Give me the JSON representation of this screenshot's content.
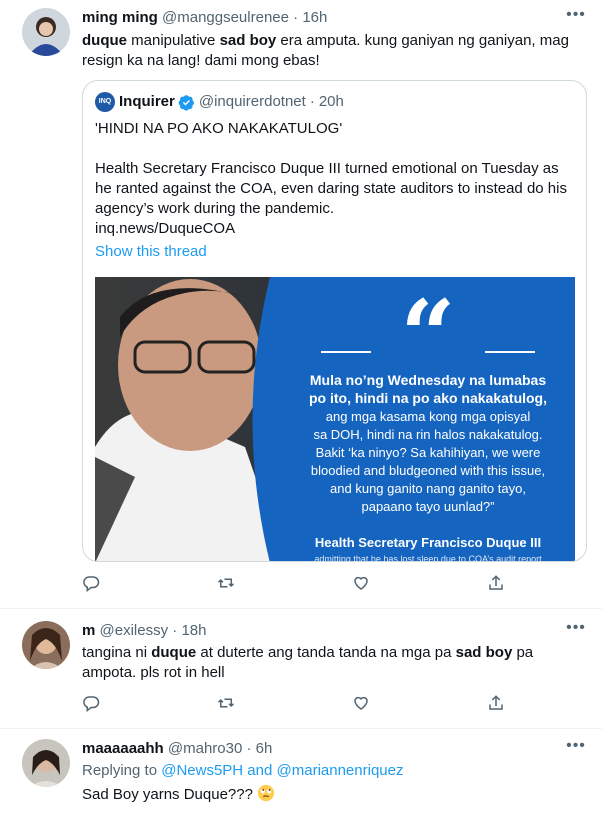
{
  "tweets": [
    {
      "name": "ming ming",
      "handle": "@manggseulrenee",
      "separator": "·",
      "time": "16h",
      "more_icon": "more-horizontal-icon",
      "text_parts": [
        {
          "t": "duque",
          "bold": true
        },
        {
          "t": " manipulative ",
          "bold": false
        },
        {
          "t": "sad boy",
          "bold": true
        },
        {
          "t": " era amputa. kung ganiyan ng ganiyan, mag resign ka na lang! dami mong ebas!",
          "bold": false
        }
      ],
      "quote": {
        "logo_text": "INQ",
        "name": "Inquirer",
        "verified_icon": "verified-badge-icon",
        "handle": "@inquirerdotnet",
        "separator": "·",
        "time": "20h",
        "headline": "'HINDI NA PO AKO NAKAKATULOG'",
        "body": "Health Secretary Francisco Duque III turned emotional on Tuesday as he ranted against the COA, even daring state auditors to instead do his agency’s work during the pandemic.",
        "url": "inq.news/DuqueCOA",
        "show_thread": "Show this thread",
        "image": {
          "quote_mark": "“",
          "quote_bold_1": "Mula no’ng Wednesday na lumabas",
          "quote_bold_2": "po ito, hindi na po ako nakakatulog,",
          "quote_lines": [
            "ang mga kasama kong mga opisyal",
            "sa DOH, hindi na rin halos nakakatulog.",
            "Bakit ‘ka ninyo?  Sa kahihiyan, we were",
            "bloodied and bludgeoned with this issue,",
            "and kung ganito nang ganito tayo,",
            "papaano tayo uunlad?”"
          ],
          "attribution": "Health Secretary Francisco Duque III",
          "caption": "admitting that he has lost sleep due to COA’s audit report"
        }
      }
    },
    {
      "name": "m",
      "handle": "@exilessy",
      "separator": "·",
      "time": "18h",
      "more_icon": "more-horizontal-icon",
      "text_parts": [
        {
          "t": "tangina ni ",
          "bold": false
        },
        {
          "t": "duque",
          "bold": true
        },
        {
          "t": " at duterte ang tanda tanda na mga pa ",
          "bold": false
        },
        {
          "t": "sad boy",
          "bold": true
        },
        {
          "t": " pa ampota. pls rot in hell",
          "bold": false
        }
      ]
    },
    {
      "name": "maaaaaahh",
      "handle": "@mahro30",
      "separator": "·",
      "time": "6h",
      "more_icon": "more-horizontal-icon",
      "replying_prefix": "Replying to ",
      "replying_user1": "@News5PH",
      "replying_and": " and ",
      "replying_user2": "@mariannenriquez",
      "text": "Sad Boy yarns Duque??? ",
      "emoji_icon": "face-with-rolling-eyes-emoji"
    }
  ],
  "action_icons": [
    "reply-icon",
    "retweet-icon",
    "like-icon",
    "share-icon"
  ],
  "colors": {
    "accent": "#1d9bf0",
    "secondary_text": "#536471",
    "border": "#cfd9de",
    "quote_bg": "#1565c0"
  }
}
